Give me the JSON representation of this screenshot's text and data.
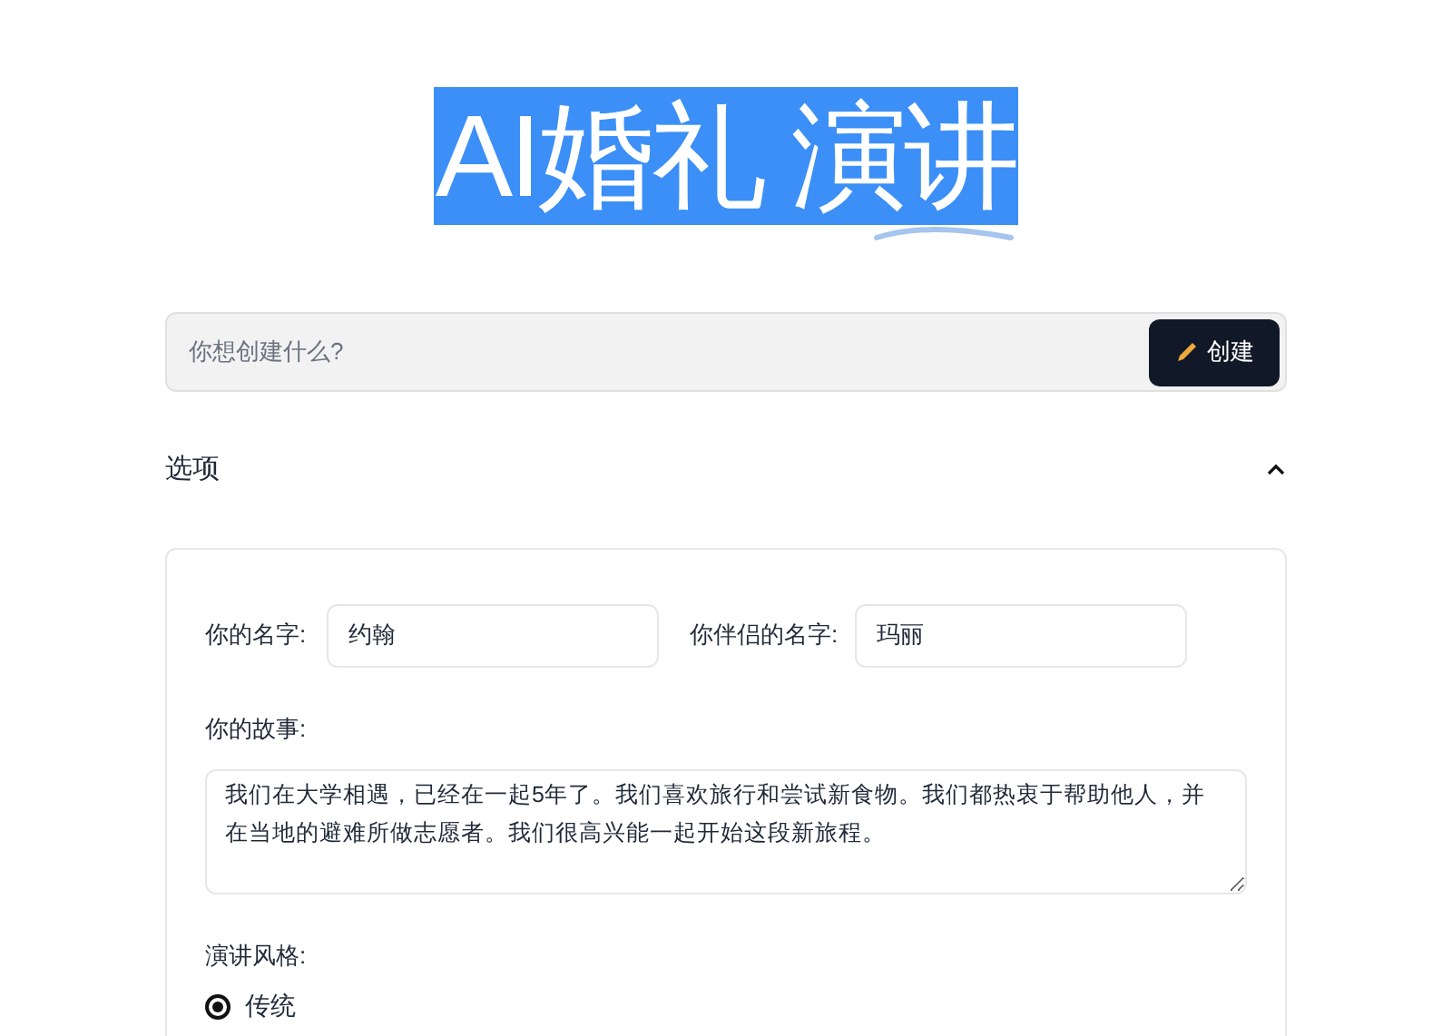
{
  "title": {
    "text": "AI婚礼 演讲",
    "highlighted": true
  },
  "prompt": {
    "placeholder": "你想创建什么?",
    "button": "创建"
  },
  "options": {
    "label": "选项",
    "expanded": true
  },
  "form": {
    "name_label": "你的名字:",
    "name_value": "约翰",
    "partner_label": "你伴侣的名字:",
    "partner_value": "玛丽",
    "story_label": "你的故事:",
    "story_value": "我们在大学相遇，已经在一起5年了。我们喜欢旅行和尝试新食物。我们都热衷于帮助他人，并在当地的避难所做志愿者。我们很高兴能一起开始这段新旅程。",
    "style_label": "演讲风格:",
    "styles": [
      {
        "label": "传统",
        "selected": true
      }
    ]
  }
}
